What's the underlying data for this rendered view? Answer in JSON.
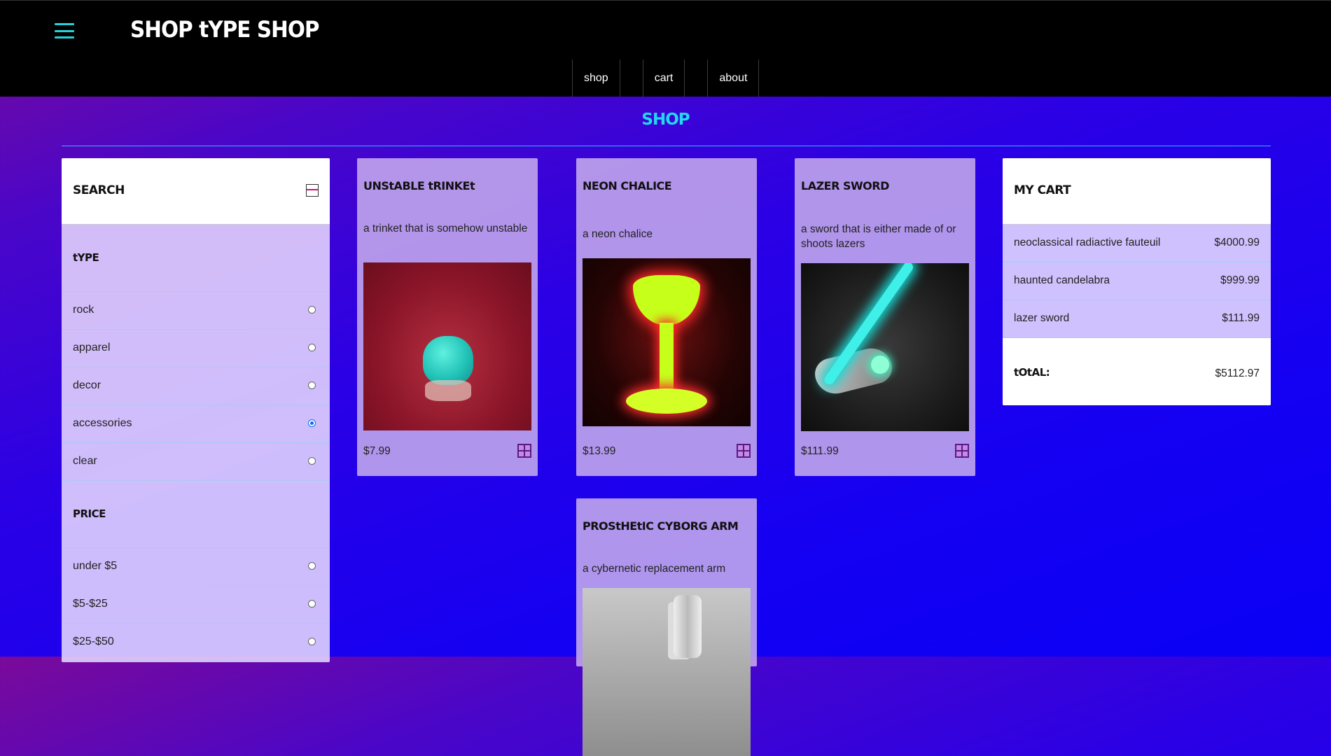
{
  "header": {
    "site_title": "SHOP tYPE SHOP",
    "nav": [
      "shop",
      "cart",
      "about"
    ]
  },
  "page": {
    "heading": "SHOP"
  },
  "search_panel": {
    "title": "SEARCH",
    "type_group": {
      "title": "tYPE",
      "options": [
        {
          "label": "rock",
          "selected": false
        },
        {
          "label": "apparel",
          "selected": false
        },
        {
          "label": "decor",
          "selected": false
        },
        {
          "label": "accessories",
          "selected": true
        },
        {
          "label": "clear",
          "selected": false
        }
      ]
    },
    "price_group": {
      "title": "PRICE",
      "options": [
        {
          "label": "under $5",
          "selected": false
        },
        {
          "label": "$5-$25",
          "selected": false
        },
        {
          "label": "$25-$50",
          "selected": false
        }
      ]
    }
  },
  "products": [
    {
      "name": "UNStABLE tRINKEt",
      "description": "a trinket that is somehow unstable",
      "price": "$7.99",
      "image": "teal-trinket-on-red"
    },
    {
      "name": "NEON CHALICE",
      "description": "a neon chalice",
      "price": "$13.99",
      "image": "glowing-yellow-chalice"
    },
    {
      "name": "LAZER SWORD",
      "description": "a sword that is either made of or shoots lazers",
      "price": "$111.99",
      "image": "cyan-laser-sword"
    },
    {
      "name": "PROStHEtIC CYBORG ARM",
      "description": "a cybernetic replacement arm",
      "price": "",
      "image": "robotic-arm"
    }
  ],
  "cart": {
    "title": "MY CART",
    "items": [
      {
        "name": "neoclassical radiactive fauteuil",
        "price": "$4000.99"
      },
      {
        "name": "haunted candelabra",
        "price": "$999.99"
      },
      {
        "name": "lazer sword",
        "price": "$111.99"
      }
    ],
    "total_label": "tOtAL:",
    "total_value": "$5112.97"
  },
  "colors": {
    "accent": "#22d8f0",
    "header_bg": "#000000",
    "selected_radio": "#0a6cf0"
  }
}
